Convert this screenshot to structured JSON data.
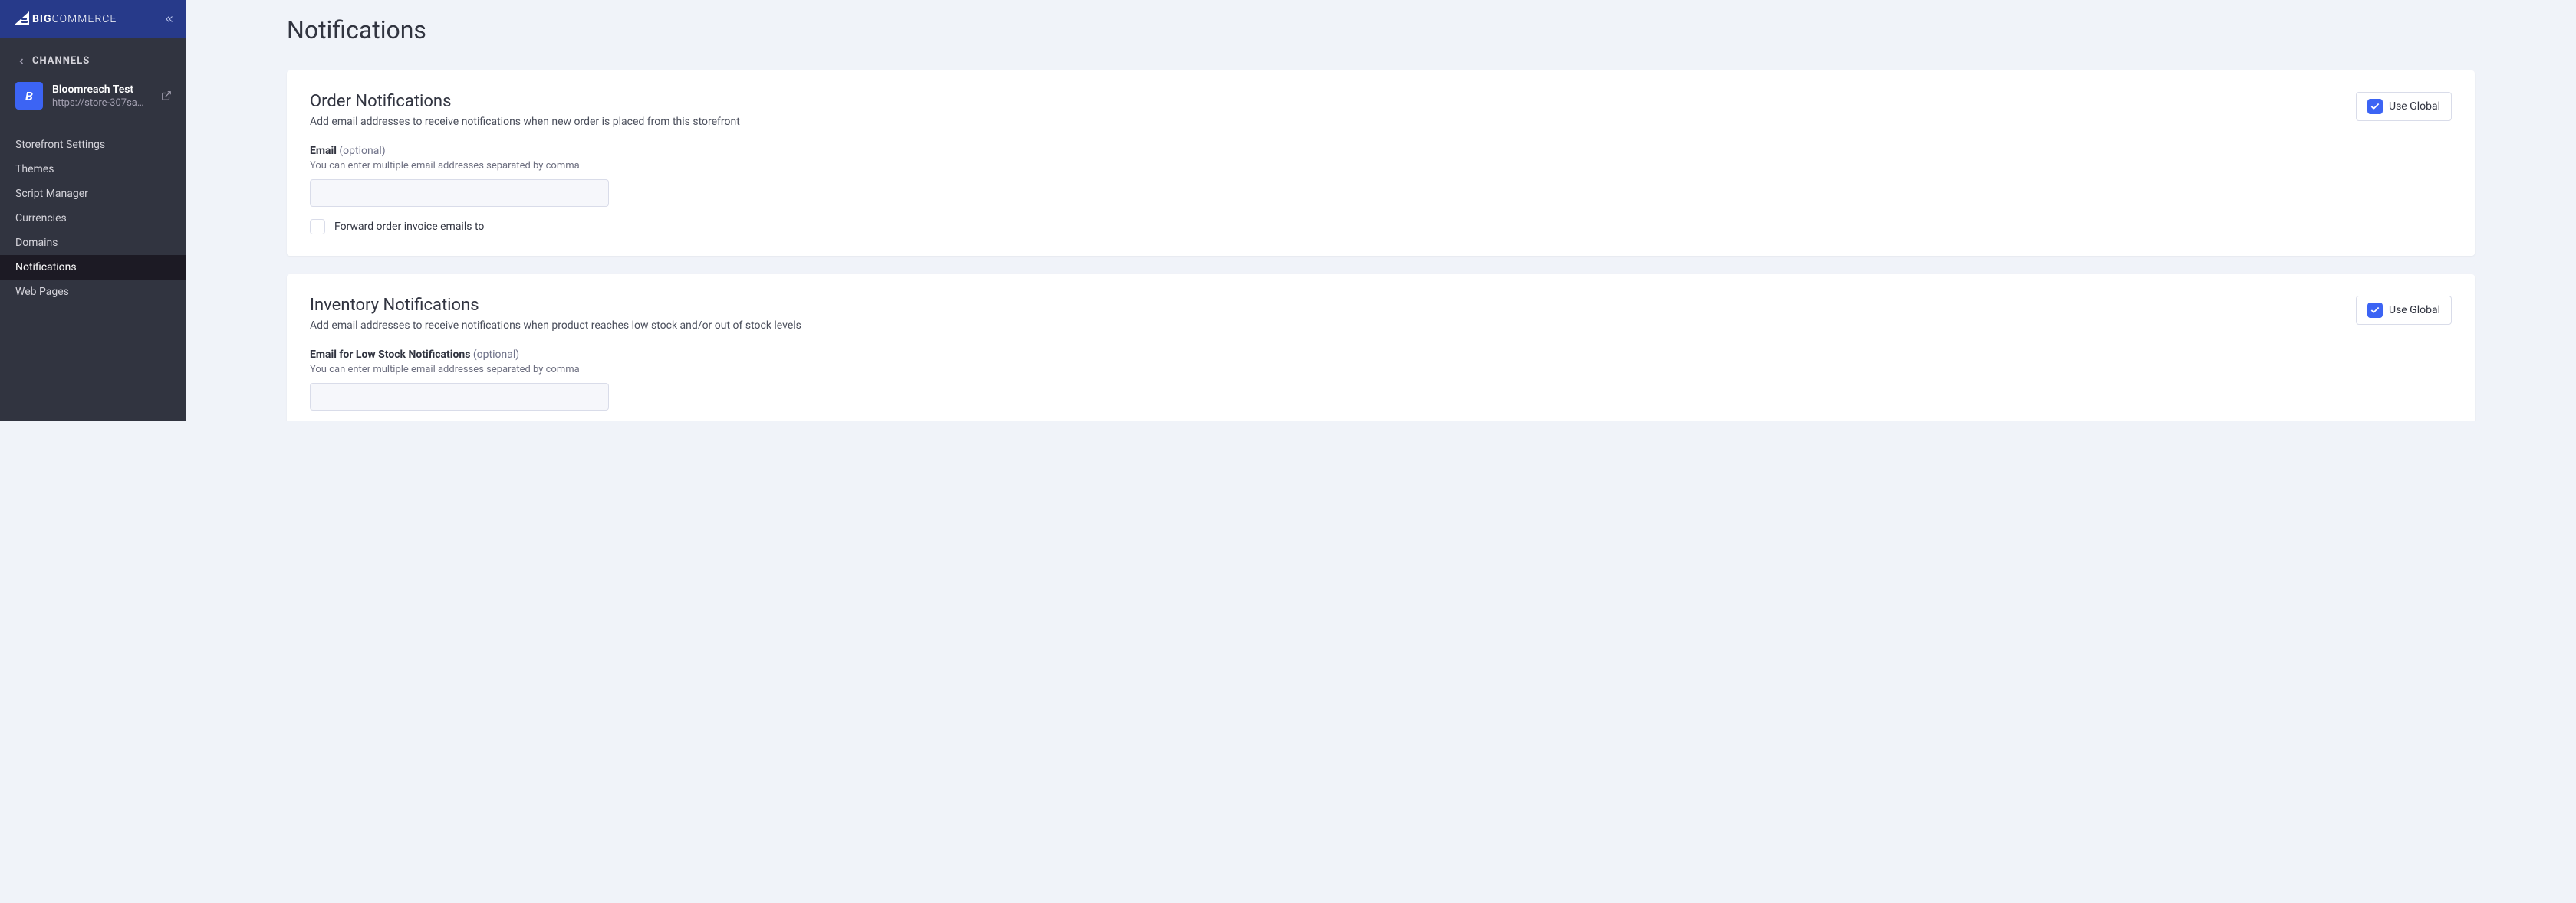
{
  "logo": {
    "bold": "BIG",
    "rest": "COMMERCE"
  },
  "channels_label": "CHANNELS",
  "channel": {
    "name": "Bloomreach Test",
    "url": "https://store-307sa…",
    "icon_text": "B"
  },
  "nav": {
    "items": [
      {
        "label": "Storefront Settings",
        "active": false
      },
      {
        "label": "Themes",
        "active": false
      },
      {
        "label": "Script Manager",
        "active": false
      },
      {
        "label": "Currencies",
        "active": false
      },
      {
        "label": "Domains",
        "active": false
      },
      {
        "label": "Notifications",
        "active": true
      },
      {
        "label": "Web Pages",
        "active": false
      }
    ]
  },
  "page": {
    "title": "Notifications"
  },
  "order_card": {
    "title": "Order Notifications",
    "desc": "Add email addresses to receive notifications when new order is placed from this storefront",
    "use_global": "Use Global",
    "email_label": "Email",
    "optional": " (optional)",
    "help": "You can enter multiple email addresses separated by comma",
    "input_value": "",
    "forward_label": "Forward order invoice emails to"
  },
  "inventory_card": {
    "title": "Inventory Notifications",
    "desc": "Add email addresses to receive notifications when product reaches low stock and/or out of stock levels",
    "use_global": "Use Global",
    "email_low_label": "Email for Low Stock Notifications",
    "optional": " (optional)",
    "help": "You can enter multiple email addresses separated by comma",
    "input_value": ""
  }
}
